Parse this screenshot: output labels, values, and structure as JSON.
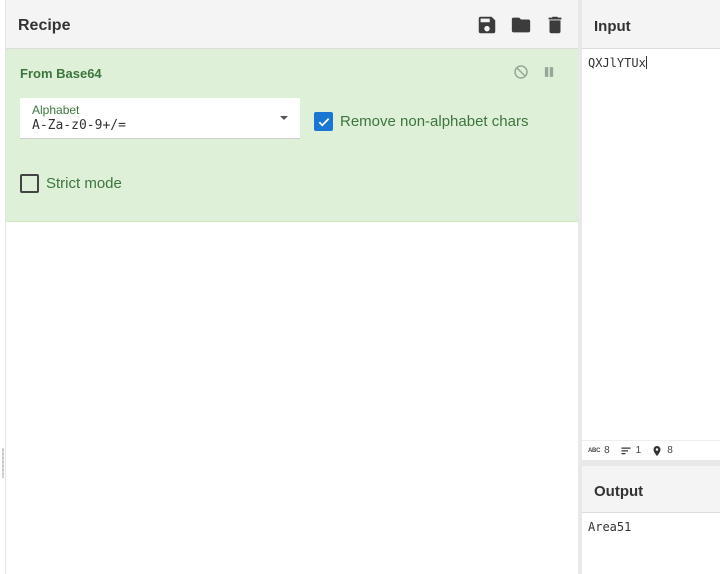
{
  "recipe": {
    "title": "Recipe",
    "header_icons": [
      "save-icon",
      "folder-icon",
      "trash-icon"
    ]
  },
  "operation": {
    "title": "From Base64",
    "controls": [
      "disable-icon",
      "pause-icon"
    ],
    "alphabet": {
      "label": "Alphabet",
      "value": "A-Za-z0-9+/="
    },
    "remove_non_alphabet": {
      "label": "Remove non-alphabet chars",
      "checked": true
    },
    "strict_mode": {
      "label": "Strict mode",
      "checked": false
    }
  },
  "input": {
    "title": "Input",
    "text": "QXJlYTUx",
    "stats": {
      "length": "8",
      "lines": "1",
      "position": "8"
    }
  },
  "output": {
    "title": "Output",
    "text": "Area51"
  },
  "colors": {
    "operation_bg": "#dff0d8",
    "operation_text": "#3c763d",
    "checkbox_checked": "#1976d2"
  }
}
